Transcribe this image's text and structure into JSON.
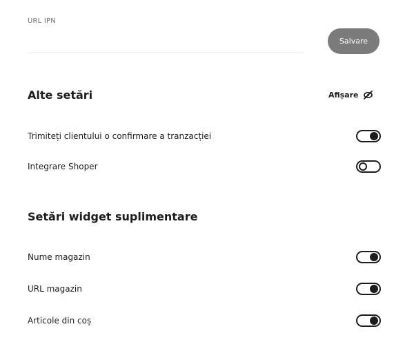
{
  "ipn": {
    "label": "URL IPN",
    "value": "",
    "placeholder": ""
  },
  "save_button": {
    "label": "Salvare"
  },
  "other_settings": {
    "title": "Alte setări",
    "display_label": "Afișare",
    "display_icon": "eye-off-icon",
    "rows": [
      {
        "label": "Trimiteți clientului o confirmare a tranzacției",
        "enabled": true
      },
      {
        "label": "Integrare Shoper",
        "enabled": false
      }
    ]
  },
  "widget_settings": {
    "title": "Setări widget suplimentare",
    "rows": [
      {
        "label": "Nume magazin",
        "enabled": true
      },
      {
        "label": "URL magazin",
        "enabled": true
      },
      {
        "label": "Articole din coș",
        "enabled": true
      }
    ]
  }
}
